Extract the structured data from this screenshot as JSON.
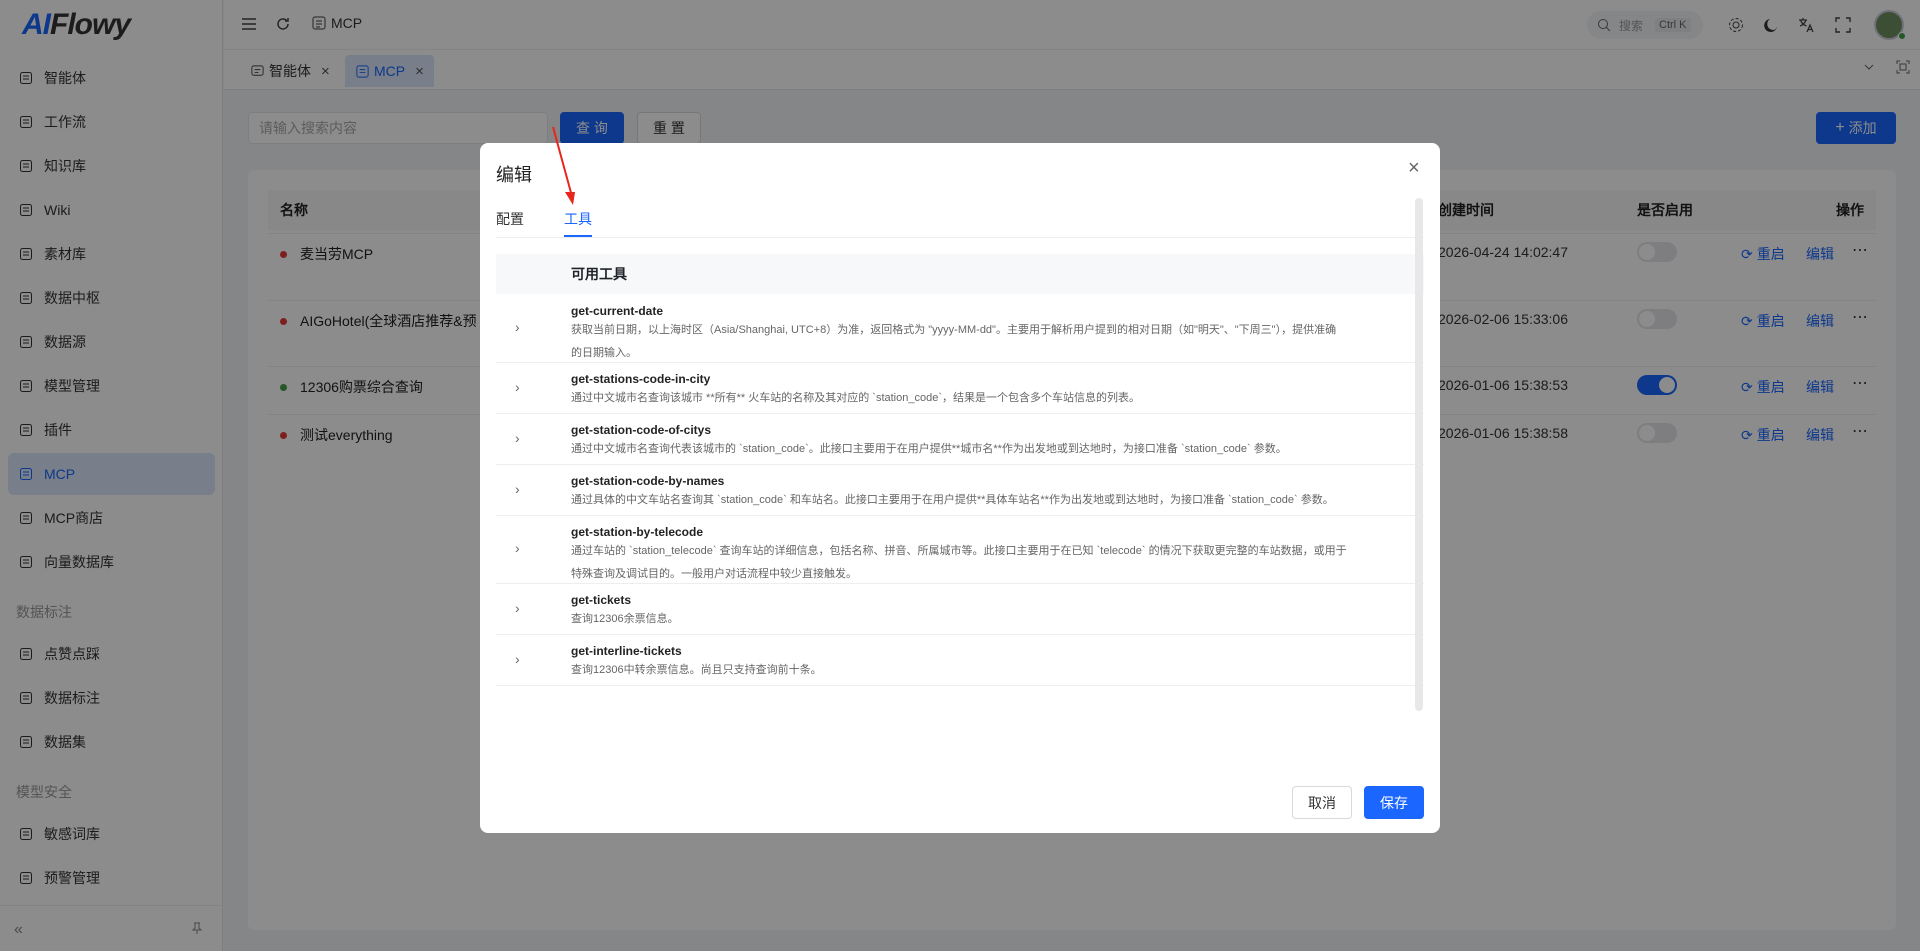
{
  "app": {
    "logo_a": "AI",
    "logo_b": "Flowy"
  },
  "sidebar": {
    "items": [
      {
        "label": "智能体",
        "icon": "chat-icon"
      },
      {
        "label": "工作流",
        "icon": "workflow-icon"
      },
      {
        "label": "知识库",
        "icon": "book-icon"
      },
      {
        "label": "Wiki",
        "icon": "doc-icon"
      },
      {
        "label": "素材库",
        "icon": "layers-icon"
      },
      {
        "label": "数据中枢",
        "icon": "database-icon"
      },
      {
        "label": "数据源",
        "icon": "database-icon"
      },
      {
        "label": "模型管理",
        "icon": "model-icon"
      },
      {
        "label": "插件",
        "icon": "plugin-icon"
      },
      {
        "label": "MCP",
        "icon": "mcp-icon",
        "active": true
      },
      {
        "label": "MCP商店",
        "icon": "store-icon"
      },
      {
        "label": "向量数据库",
        "icon": "database-icon"
      }
    ],
    "group_annotation": "数据标注",
    "annotation_items": [
      {
        "label": "点赞点踩",
        "icon": "bulb-icon"
      },
      {
        "label": "数据标注",
        "icon": "tag-icon"
      },
      {
        "label": "数据集",
        "icon": "dataset-icon"
      }
    ],
    "group_security": "模型安全",
    "security_items": [
      {
        "label": "敏感词库",
        "icon": "sensitive-icon"
      },
      {
        "label": "预警管理",
        "icon": "warning-icon"
      }
    ]
  },
  "header": {
    "breadcrumb": "MCP",
    "search_placeholder": "搜索",
    "search_shortcut": "Ctrl K"
  },
  "tabs": [
    {
      "label": "智能体"
    },
    {
      "label": "MCP",
      "active": true
    }
  ],
  "toolbar": {
    "search_placeholder": "请输入搜索内容",
    "query_label": "查 询",
    "reset_label": "重 置",
    "add_label": "添加"
  },
  "table": {
    "headers": {
      "name": "名称",
      "created": "创建时间",
      "enabled": "是否启用",
      "actions": "操作"
    },
    "rows": [
      {
        "name": "麦当劳MCP",
        "status_color": "#e53935",
        "created": "2026-04-24 14:02:47",
        "enabled": false
      },
      {
        "name": "AIGoHotel(全球酒店推荐&预",
        "status_color": "#e53935",
        "created": "2026-02-06 15:33:06",
        "enabled": false
      },
      {
        "name": "12306购票综合查询",
        "status_color": "#43a047",
        "created": "2026-01-06 15:38:53",
        "enabled": true
      },
      {
        "name": "测试everything",
        "status_color": "#e53935",
        "created": "2026-01-06 15:38:58",
        "enabled": false
      }
    ],
    "restart_label": "重启",
    "edit_label": "编辑"
  },
  "modal": {
    "title": "编辑",
    "tabs": [
      "配置",
      "工具"
    ],
    "active_tab": "工具",
    "tools_header": "可用工具",
    "tools": [
      {
        "name": "get-current-date",
        "desc": [
          "获取当前日期，以上海时区（Asia/Shanghai, UTC+8）为准，返回格式为 \"yyyy-MM-dd\"。主要用于解析用户提到的相对日期（如\"明天\"、\"下周三\"），提供准确",
          "的日期输入。"
        ]
      },
      {
        "name": "get-stations-code-in-city",
        "desc": [
          "通过中文城市名查询该城市 **所有** 火车站的名称及其对应的 `station_code`，结果是一个包含多个车站信息的列表。"
        ]
      },
      {
        "name": "get-station-code-of-citys",
        "desc": [
          "通过中文城市名查询代表该城市的 `station_code`。此接口主要用于在用户提供**城市名**作为出发地或到达地时，为接口准备 `station_code` 参数。"
        ]
      },
      {
        "name": "get-station-code-by-names",
        "desc": [
          "通过具体的中文车站名查询其 `station_code` 和车站名。此接口主要用于在用户提供**具体车站名**作为出发地或到达地时，为接口准备 `station_code` 参数。"
        ]
      },
      {
        "name": "get-station-by-telecode",
        "desc": [
          "通过车站的 `station_telecode` 查询车站的详细信息，包括名称、拼音、所属城市等。此接口主要用于在已知 `telecode` 的情况下获取更完整的车站数据，或用于",
          "特殊查询及调试目的。一般用户对话流程中较少直接触发。"
        ]
      },
      {
        "name": "get-tickets",
        "desc": [
          "查询12306余票信息。"
        ]
      },
      {
        "name": "get-interline-tickets",
        "desc": [
          "查询12306中转余票信息。尚且只支持查询前十条。"
        ]
      }
    ],
    "cancel_label": "取消",
    "save_label": "保存"
  }
}
